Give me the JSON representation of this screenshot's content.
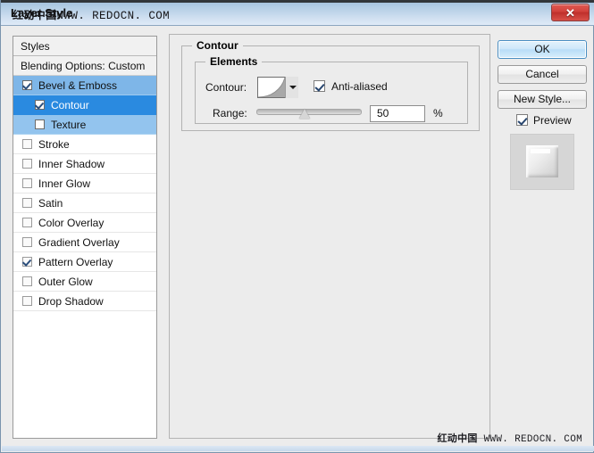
{
  "window": {
    "title": "Layer Style",
    "title_watermark_cn": "红动中国",
    "title_watermark_url": "WWW. REDOCN. COM",
    "close_glyph": "✕"
  },
  "styles_panel": {
    "header": "Styles",
    "blending_options": "Blending Options: Custom",
    "items": [
      {
        "label": "Bevel & Emboss",
        "checked": true,
        "indent": 0,
        "state": "highlighted"
      },
      {
        "label": "Contour",
        "checked": true,
        "indent": 1,
        "state": "selected"
      },
      {
        "label": "Texture",
        "checked": false,
        "indent": 1,
        "state": "highlighted"
      },
      {
        "label": "Stroke",
        "checked": false,
        "indent": 0,
        "state": "normal"
      },
      {
        "label": "Inner Shadow",
        "checked": false,
        "indent": 0,
        "state": "normal"
      },
      {
        "label": "Inner Glow",
        "checked": false,
        "indent": 0,
        "state": "normal"
      },
      {
        "label": "Satin",
        "checked": false,
        "indent": 0,
        "state": "normal"
      },
      {
        "label": "Color Overlay",
        "checked": false,
        "indent": 0,
        "state": "normal"
      },
      {
        "label": "Gradient Overlay",
        "checked": false,
        "indent": 0,
        "state": "normal"
      },
      {
        "label": "Pattern Overlay",
        "checked": true,
        "indent": 0,
        "state": "normal"
      },
      {
        "label": "Outer Glow",
        "checked": false,
        "indent": 0,
        "state": "normal"
      },
      {
        "label": "Drop Shadow",
        "checked": false,
        "indent": 0,
        "state": "normal"
      }
    ]
  },
  "contour_panel": {
    "group_title": "Contour",
    "elements_title": "Elements",
    "contour_label": "Contour:",
    "contour_swatch_name": "cone-inverted-curve",
    "antialiased_label": "Anti-aliased",
    "antialiased_checked": true,
    "range_label": "Range:",
    "range_value": "50",
    "range_unit": "%",
    "range_slider_position": 45
  },
  "buttons": {
    "ok": "OK",
    "cancel": "Cancel",
    "new_style": "New Style...",
    "preview_label": "Preview",
    "preview_checked": true
  },
  "footer": {
    "watermark_cn": "红动中国",
    "watermark_url": "WWW. REDOCN. COM"
  },
  "colors": {
    "dialog_bg": "#ececec",
    "titlebar_blue": "#aecae3",
    "selection_strong": "#2a8ae0",
    "selection_light": "#7eb6e8",
    "close_red": "#d1403a",
    "ok_blue": "#b9ddf7"
  }
}
